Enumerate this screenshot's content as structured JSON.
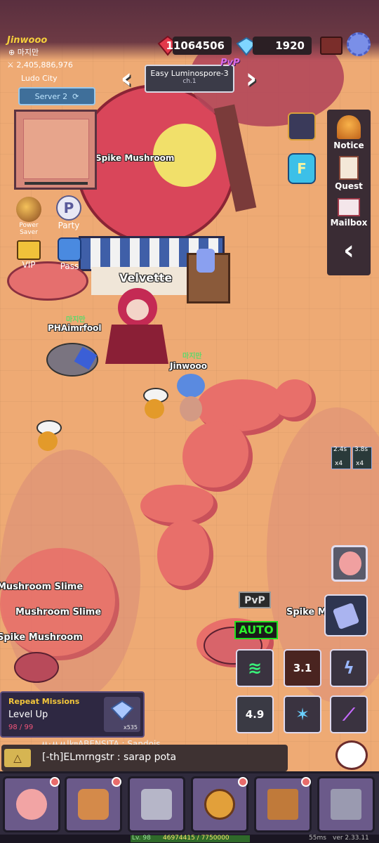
{
  "player": {
    "name": "Jinwooo",
    "guild": "마지만",
    "power": "2,405,886,976",
    "location": "Ludo City",
    "server": "Server 2"
  },
  "currency": {
    "ruby": "11064506",
    "diamond": "1920"
  },
  "stage": {
    "name": "Easy Luminospore-3",
    "chapter": "ch.1",
    "pvp": "PvP"
  },
  "left_icons": [
    {
      "label": "Power\nSaver",
      "icon": "moon-icon"
    },
    {
      "label": "Party",
      "icon": "party-icon"
    },
    {
      "label": "VIP",
      "icon": "vip-icon"
    },
    {
      "label": "Pass",
      "icon": "pass-icon"
    }
  ],
  "right_panel": [
    {
      "label": "Notice",
      "icon": "bell-icon"
    },
    {
      "label": "Quest",
      "icon": "scroll-icon"
    },
    {
      "label": "Mailbox",
      "icon": "envelope-icon"
    }
  ],
  "world_labels": {
    "npc": "Velvette",
    "shop": "Spike Mushroom",
    "other_player_guild": "마지만",
    "other_player_name": "PHAimrfool",
    "self_guild": "마지만",
    "self_name": "Jinwooo",
    "mon1": "Mushroom Slime",
    "mon2": "Mushroom Slime",
    "mon3": "Spike Mushroom",
    "mon4": "Spike Mu"
  },
  "buffs": [
    {
      "time": "2.4s",
      "stack": "x4"
    },
    {
      "time": "3.8s",
      "stack": "x4"
    }
  ],
  "controls": {
    "pvp": "PvP",
    "auto": "AUTO"
  },
  "skills": [
    {
      "icon": "green-wind-icon",
      "cooldown": ""
    },
    {
      "icon": "fire-skill-icon",
      "cooldown": "3.1"
    },
    {
      "icon": "lightning-icon",
      "cooldown": ""
    },
    {
      "icon": "summon-icon",
      "cooldown": "4.9"
    },
    {
      "icon": "blue-beast-icon",
      "cooldown": ""
    },
    {
      "icon": "sword-slash-icon",
      "cooldown": ""
    }
  ],
  "missions": {
    "header": "Repeat Missions",
    "task": "Level Up",
    "progress": "98 / 99",
    "reward_count": "x535"
  },
  "chat": {
    "previous": "ㅆ·ㅆㅆ|㎞ABENSITA : Sandois",
    "message": "[-th]ELmrngstr : sarap pota"
  },
  "nav": [
    {
      "icon": "character-icon",
      "dot": true
    },
    {
      "icon": "backpack-icon",
      "dot": true
    },
    {
      "icon": "swords-icon",
      "dot": false
    },
    {
      "icon": "compass-icon",
      "dot": true
    },
    {
      "icon": "book-icon",
      "dot": true
    },
    {
      "icon": "cart-icon",
      "dot": false
    }
  ],
  "footer": {
    "level": "Lv. 98",
    "exp": "46974415 / 7750000",
    "ping": "55ms",
    "version": "ver 2.33.11"
  }
}
